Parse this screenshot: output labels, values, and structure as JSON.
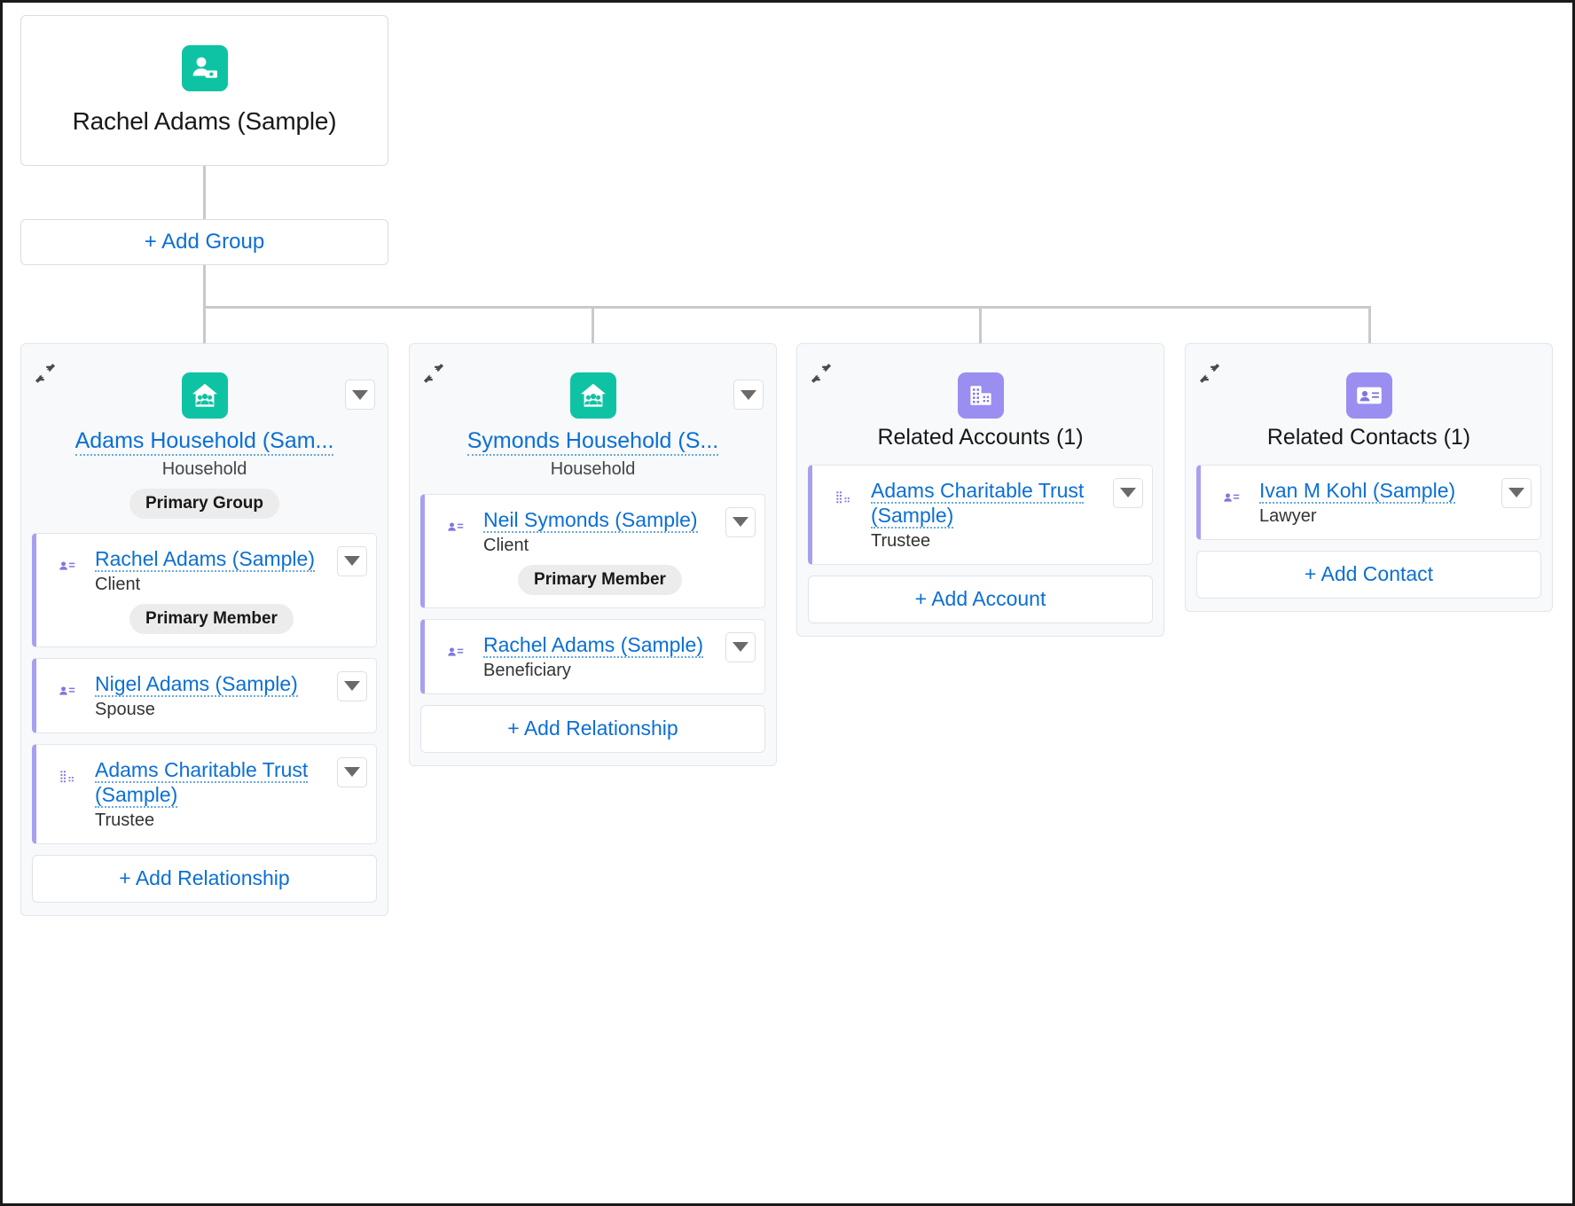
{
  "root": {
    "name": "Rachel Adams (Sample)",
    "icon": "person-money-icon",
    "icon_color": "#0ec3a4"
  },
  "add_group_button": {
    "label": "+ Add Group"
  },
  "colors": {
    "link": "#0b6fd4",
    "teal_icon": "#0ec3a4",
    "purple_icon": "#7f78e0",
    "purple_icon_light": "#9a8ef0",
    "card_bg": "#f7f9fb",
    "member_accent": "#a7a0ee",
    "connector": "#c9c9c9",
    "pill_bg": "#ececec"
  },
  "cards": [
    {
      "id": "adams-household",
      "collapse_icon": "collapse-icon",
      "menu_icon": "chevron-down-icon",
      "header_icon": "household-icon",
      "header_icon_type": "household",
      "title": "Adams Household (Sam...",
      "title_is_link": true,
      "subtype": "Household",
      "badge": "Primary Group",
      "members": [
        {
          "icon": "contact-card-icon",
          "icon_type": "contact",
          "name": "Rachel Adams (Sample)",
          "role": "Client",
          "badge": "Primary Member",
          "menu_icon": "chevron-down-icon"
        },
        {
          "icon": "contact-card-icon",
          "icon_type": "contact",
          "name": "Nigel Adams (Sample)",
          "role": "Spouse",
          "badge": null,
          "menu_icon": "chevron-down-icon"
        },
        {
          "icon": "account-building-icon",
          "icon_type": "account",
          "name": "Adams Charitable Trust (Sample)",
          "role": "Trustee",
          "badge": null,
          "menu_icon": "chevron-down-icon"
        }
      ],
      "add_button": "+ Add Relationship"
    },
    {
      "id": "symonds-household",
      "collapse_icon": "collapse-icon",
      "menu_icon": "chevron-down-icon",
      "header_icon": "household-icon",
      "header_icon_type": "household",
      "title": "Symonds Household (S...",
      "title_is_link": true,
      "subtype": "Household",
      "badge": null,
      "members": [
        {
          "icon": "contact-card-icon",
          "icon_type": "contact",
          "name": "Neil Symonds (Sample)",
          "role": "Client",
          "badge": "Primary Member",
          "menu_icon": "chevron-down-icon"
        },
        {
          "icon": "contact-card-icon",
          "icon_type": "contact",
          "name": "Rachel Adams (Sample)",
          "role": "Beneficiary",
          "badge": null,
          "menu_icon": "chevron-down-icon"
        }
      ],
      "add_button": "+ Add Relationship"
    },
    {
      "id": "related-accounts",
      "collapse_icon": "collapse-icon",
      "menu_icon": null,
      "header_icon": "account-building-icon",
      "header_icon_type": "account",
      "title": "Related Accounts (1)",
      "title_is_link": false,
      "subtype": null,
      "badge": null,
      "members": [
        {
          "icon": "account-building-icon",
          "icon_type": "account",
          "name": "Adams Charitable Trust (Sample)",
          "role": "Trustee",
          "badge": null,
          "menu_icon": "chevron-down-icon"
        }
      ],
      "add_button": "+ Add Account"
    },
    {
      "id": "related-contacts",
      "collapse_icon": "collapse-icon",
      "menu_icon": null,
      "header_icon": "contact-card-icon",
      "header_icon_type": "contact",
      "title": "Related Contacts (1)",
      "title_is_link": false,
      "subtype": null,
      "badge": null,
      "members": [
        {
          "icon": "contact-card-icon",
          "icon_type": "contact",
          "name": "Ivan M Kohl (Sample)",
          "role": "Lawyer",
          "badge": null,
          "menu_icon": "chevron-down-icon"
        }
      ],
      "add_button": "+ Add Contact"
    }
  ]
}
